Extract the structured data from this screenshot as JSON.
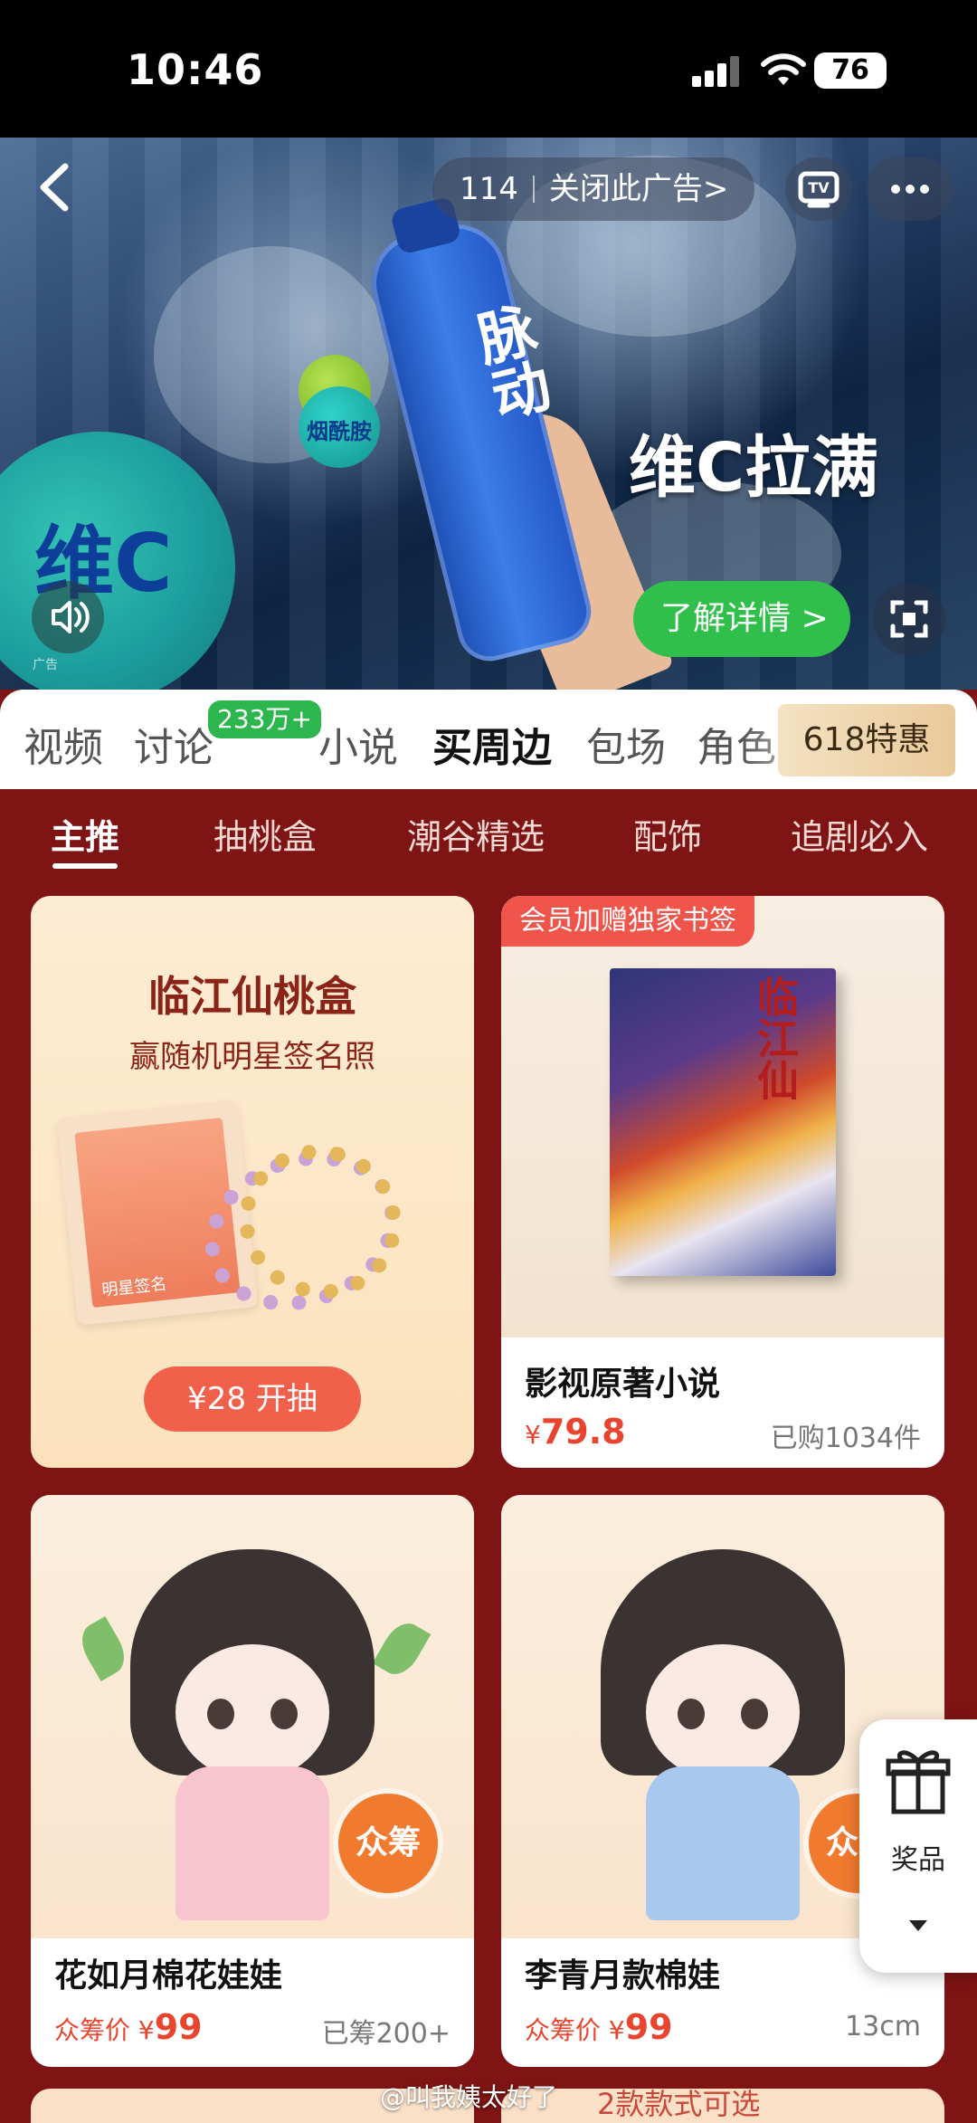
{
  "status_bar": {
    "time": "10:46",
    "battery": "76"
  },
  "ad": {
    "countdown": "114",
    "close_label": "关闭此广告>",
    "slogan": "维C拉满",
    "bottle_text": "脉动",
    "ball_big_text": "维C",
    "ball_small_text": "烟酰胺",
    "detail_button": "了解详情 >",
    "ad_tag": "广告"
  },
  "tabs": {
    "items": [
      "视频",
      "讨论",
      "小说",
      "买周边",
      "包场",
      "角色"
    ],
    "active_index": 3,
    "discuss_badge": "233万+",
    "promo_label": "618特惠"
  },
  "sub_tabs": {
    "items": [
      "主推",
      "抽桃盒",
      "潮谷精选",
      "配饰",
      "追剧必入"
    ],
    "active_index": 0
  },
  "cards": {
    "blindbox": {
      "title": "临江仙桃盒",
      "subtitle": "赢随机明星签名照",
      "photo_label": "明星签名",
      "button": "¥28 开抽"
    },
    "novel": {
      "ribbon": "会员加赠独家书签",
      "book_title": "临江仙",
      "name": "影视原著小说",
      "price_symbol": "¥",
      "price": "79.8",
      "sold": "已购1034件"
    },
    "doll1": {
      "badge": "众筹",
      "name": "花如月棉花娃娃",
      "price_prefix": "众筹价 ¥",
      "price": "99",
      "meta": "已筹200+"
    },
    "doll2": {
      "badge": "众筹",
      "name": "李青月款棉娃",
      "price_prefix": "众筹价 ¥",
      "price": "99",
      "meta": "13cm"
    }
  },
  "float_gift": {
    "label": "奖品"
  },
  "bottom_peek": {
    "label": "2款款式可选"
  },
  "watermark": "@叫我姨太好了",
  "colors": {
    "accent_red": "#7e1414",
    "price_red": "#e8442e",
    "green": "#2fbf4a"
  }
}
